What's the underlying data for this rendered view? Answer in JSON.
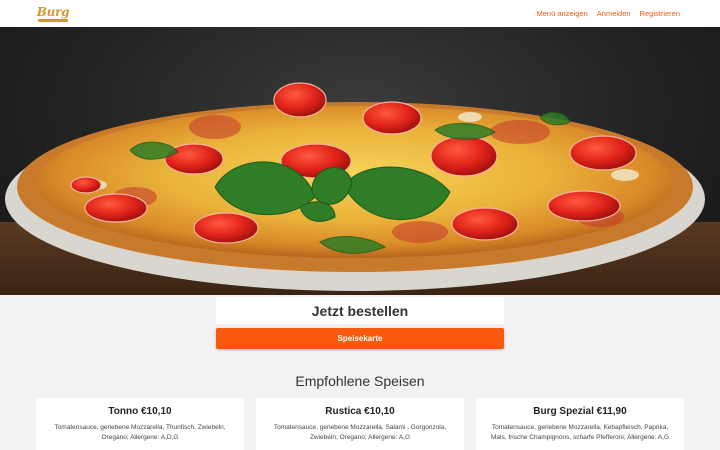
{
  "brand": {
    "logo_text": "Burg",
    "accent_color": "#ef5b15",
    "button_color": "#f75a0c"
  },
  "nav": {
    "items": [
      {
        "label": "Menü anzeigen"
      },
      {
        "label": "Anmelden"
      },
      {
        "label": "Registrieren"
      }
    ]
  },
  "hero": {
    "image": "pizza-photo"
  },
  "order": {
    "title": "Jetzt bestellen",
    "button_label": "Speisekarte"
  },
  "featured": {
    "title": "Empfohlene Speisen",
    "items": [
      {
        "title": "Tonno €10,10",
        "description": "Tomatensauce, geriebene Mozzarella, Thunfisch, Zwiebeln, Oregano; Allergene: A,D,G"
      },
      {
        "title": "Rustica €10,10",
        "description": "Tomatensauce, geriebene Mozzarella, Salami , Gorgonzola, Zwiebeln, Oregano; Allergene: A,G"
      },
      {
        "title": "Burg Spezial €11,90",
        "description": "Tomatensauce, geriebene Mozzarella, Kebapfleisch, Paprika, Mais, frische Champignons, scharfe Pfefferoni; Allergene: A,G"
      }
    ]
  }
}
